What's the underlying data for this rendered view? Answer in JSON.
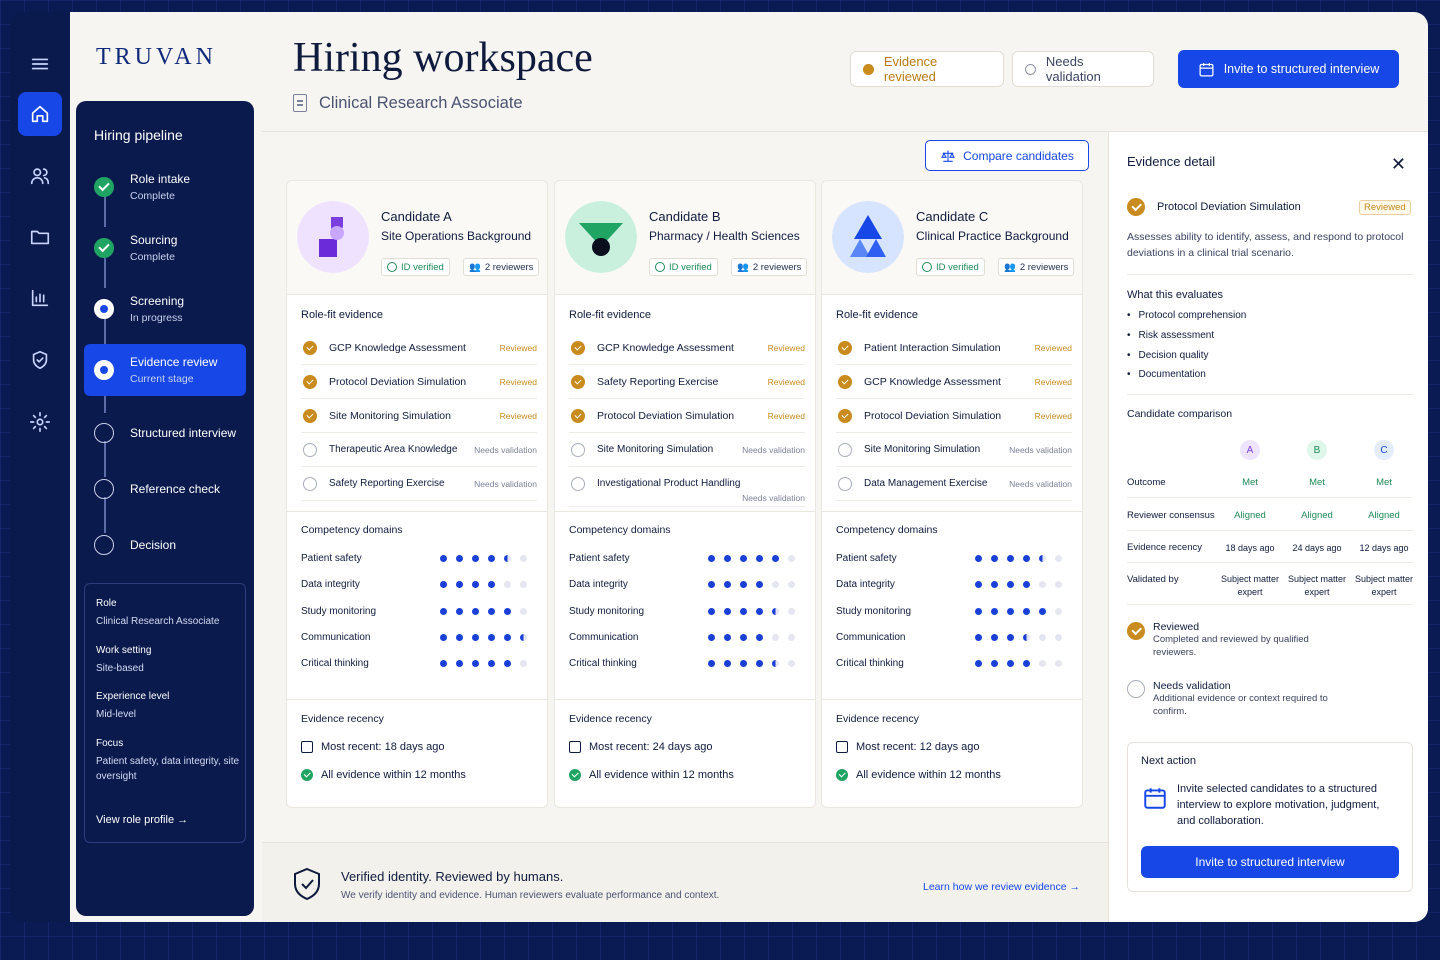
{
  "app": {
    "logo": "TRUVAN"
  },
  "header": {
    "title": "Hiring workspace",
    "role": "Clinical Research Associate",
    "chip_reviewed": "Evidence reviewed",
    "chip_needs": "Needs validation",
    "invite_button": "Invite to structured interview",
    "colors": {
      "accent": "#1747e6",
      "reviewed": "#c98a1e",
      "verified": "#1fa463"
    }
  },
  "pipeline": {
    "title": "Hiring pipeline",
    "stages": [
      {
        "name": "Role intake",
        "status": "Complete"
      },
      {
        "name": "Sourcing",
        "status": "Complete"
      },
      {
        "name": "Screening",
        "status": "In progress"
      },
      {
        "name": "Evidence review",
        "status": "Current stage"
      },
      {
        "name": "Structured interview",
        "status": ""
      },
      {
        "name": "Reference check",
        "status": ""
      },
      {
        "name": "Decision",
        "status": ""
      }
    ],
    "role_info": {
      "role_label": "Role",
      "role": "Clinical Research Associate",
      "setting_label": "Work setting",
      "setting": "Site-based",
      "level_label": "Experience level",
      "level": "Mid-level",
      "focus_label": "Focus",
      "focus": "Patient safety, data integrity, site oversight",
      "link": "View role profile →"
    }
  },
  "compare_button": "Compare candidates",
  "labels": {
    "id_verified": "ID verified",
    "reviewers": "2 reviewers",
    "role_fit": "Role-fit evidence",
    "competency": "Competency domains",
    "recency": "Evidence recency",
    "reviewed": "Reviewed",
    "needs": "Needs validation"
  },
  "candidates": [
    {
      "name": "Candidate A",
      "background": "Site Operations Background",
      "evidence": [
        {
          "label": "GCP Knowledge Assessment",
          "status": "Reviewed"
        },
        {
          "label": "Protocol Deviation Simulation",
          "status": "Reviewed"
        },
        {
          "label": "Site Monitoring Simulation",
          "status": "Reviewed"
        },
        {
          "label": "Therapeutic Area Knowledge",
          "status": "Needs validation"
        },
        {
          "label": "Safety Reporting Exercise",
          "status": "Needs validation"
        }
      ],
      "competencies": [
        {
          "name": "Patient safety",
          "level": 4.5
        },
        {
          "name": "Data integrity",
          "level": 4
        },
        {
          "name": "Study monitoring",
          "level": 5
        },
        {
          "name": "Communication",
          "level": 5.5
        },
        {
          "name": "Critical thinking",
          "level": 5
        }
      ],
      "most_recent": "Most recent: 18 days ago",
      "within": "All evidence within 12 months"
    },
    {
      "name": "Candidate B",
      "background": "Pharmacy / Health Sciences",
      "evidence": [
        {
          "label": "GCP Knowledge Assessment",
          "status": "Reviewed"
        },
        {
          "label": "Safety Reporting Exercise",
          "status": "Reviewed"
        },
        {
          "label": "Protocol Deviation Simulation",
          "status": "Reviewed"
        },
        {
          "label": "Site Monitoring Simulation",
          "status": "Needs validation"
        },
        {
          "label": "Investigational Product Handling",
          "status": "Needs validation"
        }
      ],
      "competencies": [
        {
          "name": "Patient safety",
          "level": 5
        },
        {
          "name": "Data integrity",
          "level": 4
        },
        {
          "name": "Study monitoring",
          "level": 4.5
        },
        {
          "name": "Communication",
          "level": 4
        },
        {
          "name": "Critical thinking",
          "level": 4.5
        }
      ],
      "most_recent": "Most recent: 24 days ago",
      "within": "All evidence within 12 months"
    },
    {
      "name": "Candidate C",
      "background": "Clinical Practice Background",
      "evidence": [
        {
          "label": "Patient Interaction Simulation",
          "status": "Reviewed"
        },
        {
          "label": "GCP Knowledge Assessment",
          "status": "Reviewed"
        },
        {
          "label": "Protocol Deviation Simulation",
          "status": "Reviewed"
        },
        {
          "label": "Site Monitoring Simulation",
          "status": "Needs validation"
        },
        {
          "label": "Data Management Exercise",
          "status": "Needs validation"
        }
      ],
      "competencies": [
        {
          "name": "Patient safety",
          "level": 4.5
        },
        {
          "name": "Data integrity",
          "level": 4
        },
        {
          "name": "Study monitoring",
          "level": 5
        },
        {
          "name": "Communication",
          "level": 3.5
        },
        {
          "name": "Critical thinking",
          "level": 4
        }
      ],
      "most_recent": "Most recent: 12 days ago",
      "within": "All evidence within 12 months"
    }
  ],
  "footer": {
    "title": "Verified identity. Reviewed by humans.",
    "text": "We verify identity and evidence. Human reviewers evaluate performance and context.",
    "link": "Learn how we review evidence →"
  },
  "detail": {
    "title": "Evidence detail",
    "item": "Protocol Deviation Simulation",
    "badge": "Reviewed",
    "description": "Assesses ability to identify, assess, and respond to protocol deviations in a clinical trial scenario.",
    "evaluates_title": "What this evaluates",
    "evaluates": [
      "Protocol comprehension",
      "Risk assessment",
      "Decision quality",
      "Documentation"
    ],
    "comparison_title": "Candidate comparison",
    "rows": [
      {
        "label": "Outcome",
        "values": [
          "Met",
          "Met",
          "Met"
        ]
      },
      {
        "label": "Reviewer consensus",
        "values": [
          "Aligned",
          "Aligned",
          "Aligned"
        ]
      },
      {
        "label": "Evidence recency",
        "values": [
          "18 days ago",
          "24 days ago",
          "12 days ago"
        ]
      },
      {
        "label": "Validated by",
        "values": [
          "Subject matter expert",
          "Subject matter expert",
          "Subject matter expert"
        ]
      }
    ],
    "avatars": [
      "A",
      "B",
      "C"
    ],
    "legend_reviewed": "Reviewed",
    "legend_reviewed_text": "Completed and reviewed by qualified reviewers.",
    "legend_needs": "Needs validation",
    "legend_needs_text": "Additional evidence or context required to confirm.",
    "next_title": "Next action",
    "next_text": "Invite selected candidates to a structured interview to explore motivation, judgment, and collaboration.",
    "next_button": "Invite to structured interview"
  }
}
